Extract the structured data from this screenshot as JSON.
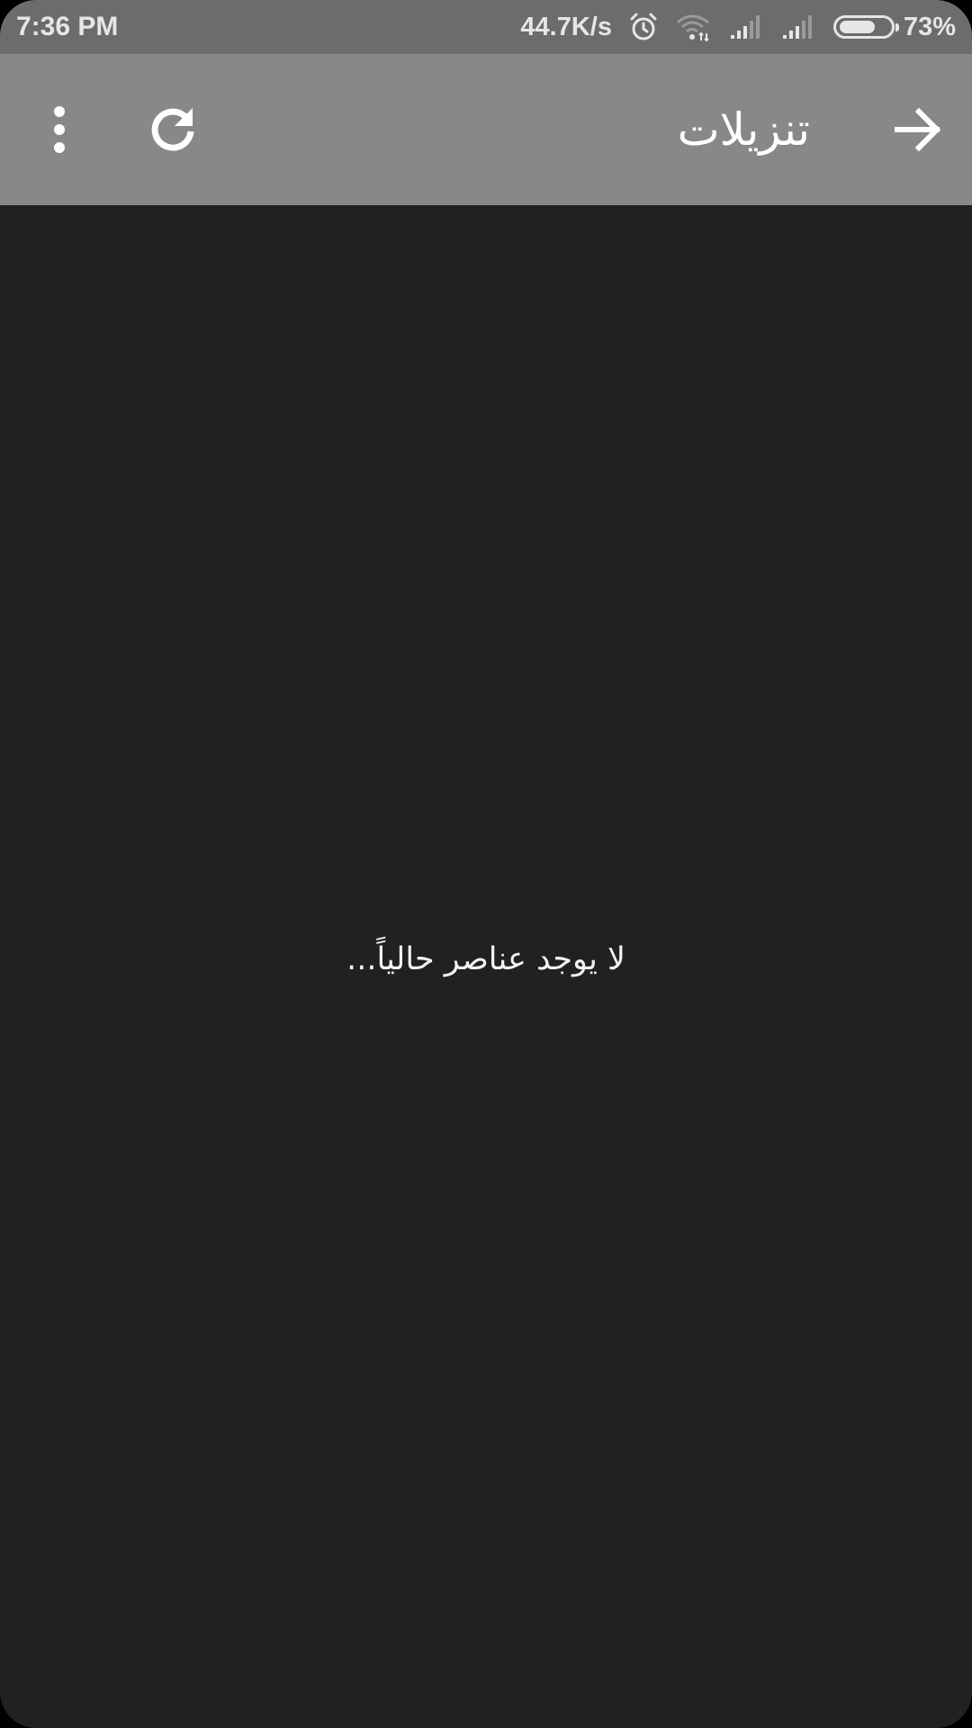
{
  "status_bar": {
    "time": "7:36 PM",
    "network_speed": "44.7K/s",
    "battery_percent": "73%",
    "battery_level": 0.73,
    "icons": [
      "alarm-icon",
      "wifi-icon",
      "signal-icon",
      "signal-icon",
      "battery-icon"
    ]
  },
  "app_bar": {
    "title": "تنزيلات",
    "back_icon": "arrow-forward-icon",
    "refresh_icon": "refresh-icon",
    "menu_icon": "more-vert-icon"
  },
  "main": {
    "empty_message": "لا يوجد عناصر حالياً..."
  },
  "colors": {
    "status_bar": "#6c6c6c",
    "app_bar": "#888888",
    "background": "#212121",
    "text": "#ffffff"
  }
}
